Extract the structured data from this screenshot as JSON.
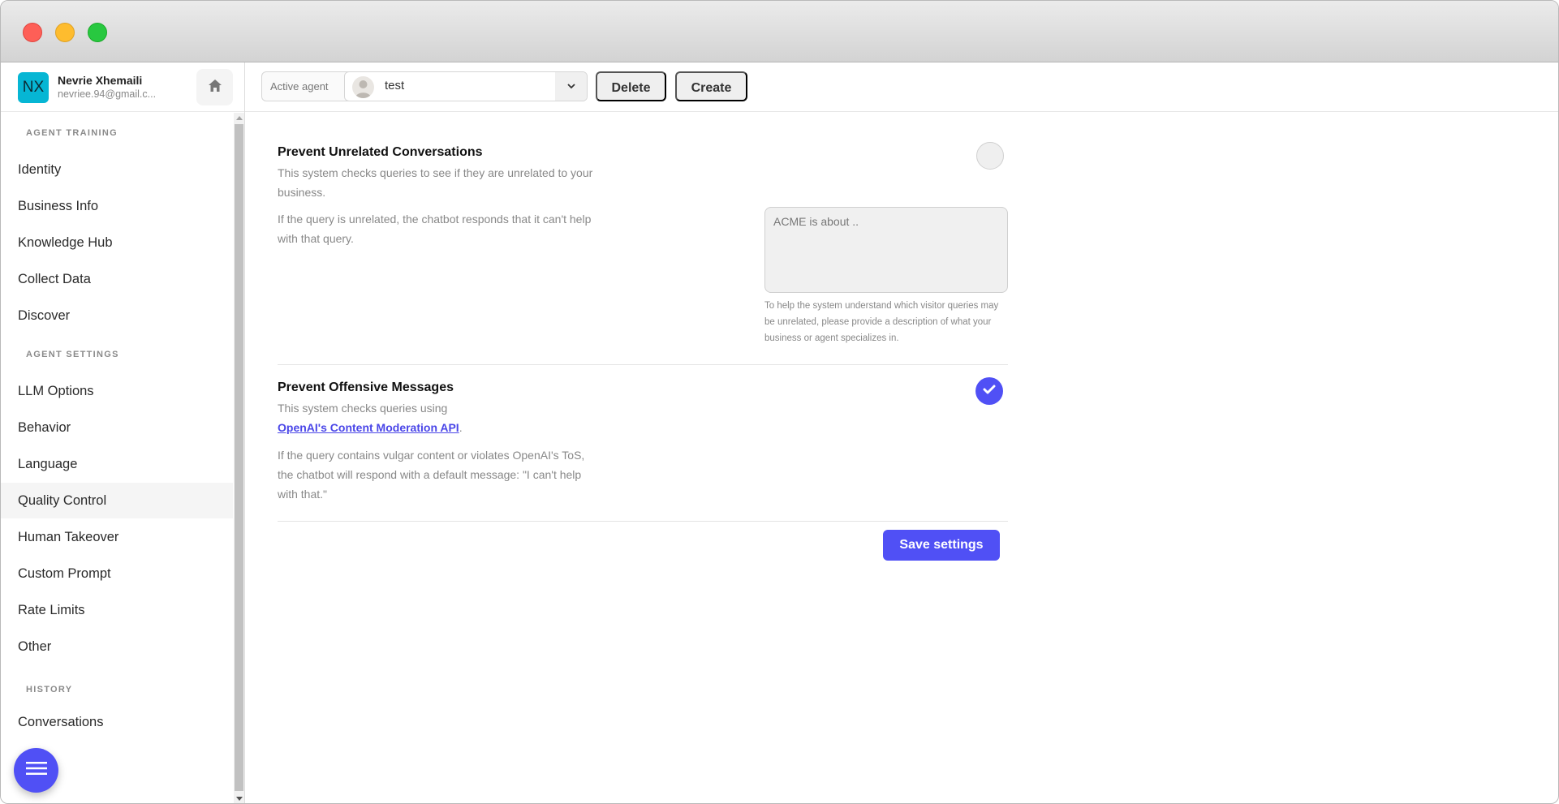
{
  "window": {
    "controls": [
      "close",
      "minimize",
      "maximize"
    ]
  },
  "user": {
    "initials": "NX",
    "name": "Nevrie Xhemaili",
    "email": "nevriee.94@gmail.c..."
  },
  "sidebar": {
    "sections": [
      {
        "label": "AGENT TRAINING",
        "items": [
          "Identity",
          "Business Info",
          "Knowledge Hub",
          "Collect Data",
          "Discover"
        ]
      },
      {
        "label": "AGENT SETTINGS",
        "items": [
          "LLM Options",
          "Behavior",
          "Language",
          "Quality Control",
          "Human Takeover",
          "Custom Prompt",
          "Rate Limits",
          "Other"
        ]
      },
      {
        "label": "HISTORY",
        "items": [
          "Conversations"
        ]
      }
    ],
    "active_item": "Quality Control"
  },
  "header": {
    "active_agent_label": "Active agent",
    "selected_agent": "test",
    "delete_label": "Delete",
    "create_label": "Create"
  },
  "quality_control": {
    "unrelated": {
      "title": "Prevent Unrelated Conversations",
      "description": "This system checks queries to see if they are unrelated to your business.",
      "detail": "If the query is unrelated, the chatbot responds that it can't help with that query.",
      "enabled": false,
      "textarea_placeholder": "ACME is about ..",
      "textarea_value": "",
      "help": "To help the system understand which visitor queries may be unrelated, please provide a description of what your business or agent specializes in."
    },
    "offensive": {
      "title": "Prevent Offensive Messages",
      "description_prefix": "This system checks queries using",
      "link_text": "OpenAI's Content Moderation API",
      "description_suffix": ".",
      "detail": "If the query contains vulgar content or violates OpenAI's ToS, the chatbot will respond with a default message: \"I can't help with that.\"",
      "enabled": true
    },
    "save_label": "Save settings"
  },
  "colors": {
    "accent": "#5050f5",
    "avatar_bg": "#06b6d4",
    "link": "#4a46e8"
  }
}
